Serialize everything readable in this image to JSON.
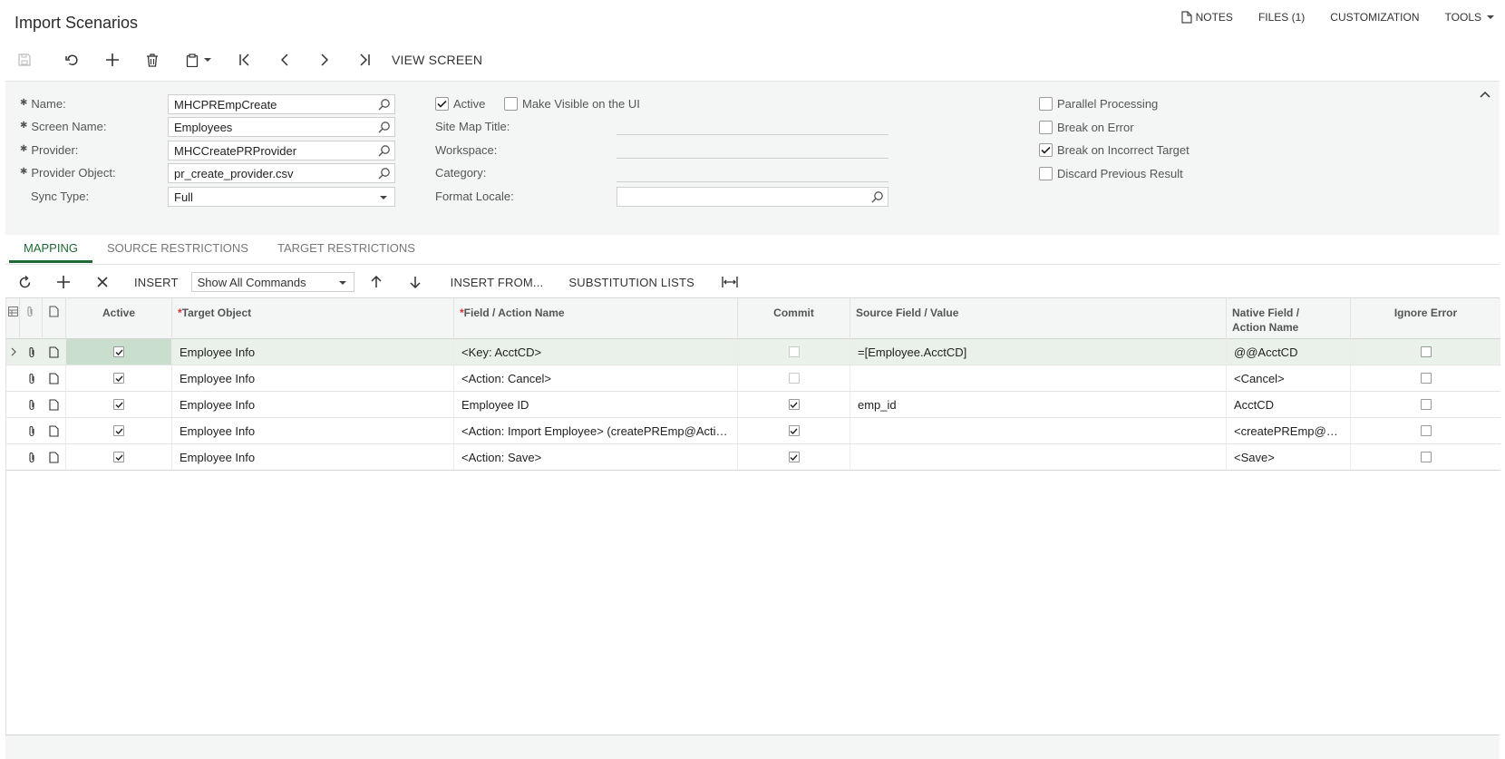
{
  "page": {
    "title": "Import Scenarios"
  },
  "top_links": {
    "notes": "NOTES",
    "files": "FILES (1)",
    "customization": "CUSTOMIZATION",
    "tools": "TOOLS"
  },
  "toolbar": {
    "view_screen": "VIEW SCREEN"
  },
  "form": {
    "name": {
      "label": "Name:",
      "value": "MHCPREmpCreate"
    },
    "screen_name": {
      "label": "Screen Name:",
      "value": "Employees"
    },
    "provider": {
      "label": "Provider:",
      "value": "MHCCreatePRProvider"
    },
    "provider_object": {
      "label": "Provider Object:",
      "value": "pr_create_provider.csv"
    },
    "sync_type": {
      "label": "Sync Type:",
      "value": "Full"
    },
    "active": {
      "label": "Active",
      "checked": true
    },
    "make_visible": {
      "label": "Make Visible on the UI",
      "checked": false
    },
    "site_map_title": {
      "label": "Site Map Title:"
    },
    "workspace": {
      "label": "Workspace:"
    },
    "category": {
      "label": "Category:"
    },
    "format_locale": {
      "label": "Format Locale:"
    },
    "parallel_processing": {
      "label": "Parallel Processing",
      "checked": false
    },
    "break_on_error": {
      "label": "Break on Error",
      "checked": false
    },
    "break_on_incorrect_target": {
      "label": "Break on Incorrect Target",
      "checked": true
    },
    "discard_previous_result": {
      "label": "Discard Previous Result",
      "checked": false
    }
  },
  "tabs": [
    {
      "label": "MAPPING",
      "active": true
    },
    {
      "label": "SOURCE RESTRICTIONS",
      "active": false
    },
    {
      "label": "TARGET RESTRICTIONS",
      "active": false
    }
  ],
  "grid_toolbar": {
    "insert": "INSERT",
    "command_filter": "Show All Commands",
    "insert_from": "INSERT FROM...",
    "substitution_lists": "SUBSTITUTION LISTS"
  },
  "grid": {
    "headers": {
      "active": "Active",
      "target_object": "Target Object",
      "field_action": "Field / Action Name",
      "commit": "Commit",
      "source_field": "Source Field / Value",
      "native_field_1": "Native Field /",
      "native_field_2": "Action Name",
      "ignore_error": "Ignore Error"
    },
    "rows": [
      {
        "active": true,
        "target": "Employee Info",
        "field": "<Key: AcctCD>",
        "commit": false,
        "source": "=[Employee.AcctCD]",
        "native": "@@AcctCD",
        "ignore": false
      },
      {
        "active": true,
        "target": "Employee Info",
        "field": "<Action: Cancel>",
        "commit": false,
        "source": "",
        "native": "<Cancel>",
        "ignore": false
      },
      {
        "active": true,
        "target": "Employee Info",
        "field": "Employee ID",
        "commit": true,
        "source": "emp_id",
        "native": "AcctCD",
        "ignore": false
      },
      {
        "active": true,
        "target": "Employee Info",
        "field": "<Action: Import Employee> (createPREmp@Acti…",
        "commit": true,
        "source": "",
        "native": "<createPREmp@…",
        "ignore": false
      },
      {
        "active": true,
        "target": "Employee Info",
        "field": "<Action: Save>",
        "commit": true,
        "source": "",
        "native": "<Save>",
        "ignore": false
      }
    ]
  }
}
